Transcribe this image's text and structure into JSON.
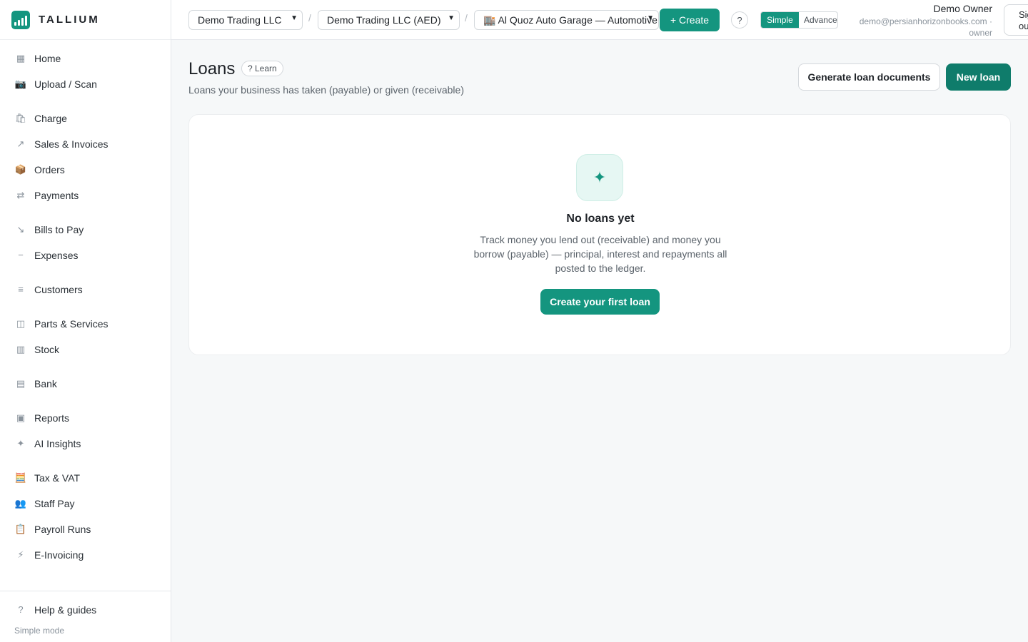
{
  "brand": {
    "name": "TALLIUM",
    "logo_icon": "bar-chart-logo-icon",
    "accent": "#14957f"
  },
  "sidebar": {
    "items": [
      {
        "label": "Home",
        "icon": "grid-icon",
        "glyph": "▦"
      },
      {
        "label": "Upload / Scan",
        "icon": "camera-icon",
        "glyph": "📷"
      },
      {
        "label": "Charge",
        "icon": "shopping-bag-icon",
        "glyph": "🛍"
      },
      {
        "label": "Sales & Invoices",
        "icon": "arrow-up-right-icon",
        "glyph": "↗"
      },
      {
        "label": "Orders",
        "icon": "package-icon",
        "glyph": "📦"
      },
      {
        "label": "Payments",
        "icon": "arrows-exchange-icon",
        "glyph": "⇄"
      },
      {
        "label": "Bills to Pay",
        "icon": "arrow-down-right-icon",
        "glyph": "↘"
      },
      {
        "label": "Expenses",
        "icon": "minus-icon",
        "glyph": "−"
      },
      {
        "label": "Customers",
        "icon": "list-icon",
        "glyph": "≡"
      },
      {
        "label": "Parts & Services",
        "icon": "columns-icon",
        "glyph": "◫"
      },
      {
        "label": "Stock",
        "icon": "shelves-icon",
        "glyph": "▥"
      },
      {
        "label": "Bank",
        "icon": "bank-icon",
        "glyph": "▤"
      },
      {
        "label": "Reports",
        "icon": "report-icon",
        "glyph": "▣"
      },
      {
        "label": "AI Insights",
        "icon": "sparkle-icon",
        "glyph": "✦"
      },
      {
        "label": "Tax & VAT",
        "icon": "abacus-icon",
        "glyph": "🧮"
      },
      {
        "label": "Staff Pay",
        "icon": "people-icon",
        "glyph": "👥"
      },
      {
        "label": "Payroll Runs",
        "icon": "clipboard-icon",
        "glyph": "📋"
      },
      {
        "label": "E-Invoicing",
        "icon": "lightning-icon",
        "glyph": "⚡"
      }
    ],
    "help_label": "Help & guides",
    "help_glyph": "?",
    "mode_note": "Simple mode"
  },
  "topbar": {
    "company_select": "Demo Trading LLC",
    "currency_select": "Demo Trading LLC (AED)",
    "branch_select": "🏬 Al Quoz Auto Garage — Automotive",
    "separator": "/",
    "create_label": "+ Create",
    "help_label": "?",
    "mode_simple": "Simple",
    "mode_advanced": "Advanced",
    "user_name": "Demo Owner",
    "user_email": "demo@persianhorizonbooks.com · owner",
    "signout_label": "Sign out"
  },
  "page": {
    "title": "Loans",
    "learn_label": "? Learn",
    "subtitle": "Loans your business has taken (payable) or given (receivable)",
    "generate_label": "Generate loan documents",
    "new_loan_label": "New loan"
  },
  "empty_state": {
    "icon": "sparkle-icon",
    "glyph": "✦",
    "title": "No loans yet",
    "description": "Track money you lend out (receivable) and money you borrow (payable) — principal, interest and repayments all posted to the ledger.",
    "cta_label": "Create your first loan"
  }
}
